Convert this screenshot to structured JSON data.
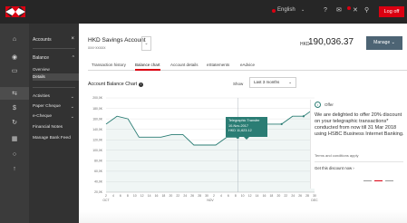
{
  "topbar": {
    "language": "English",
    "language_caret": "⌄",
    "help_icon": "?",
    "mail_icon": "✉",
    "user_icon": "✕",
    "search_icon": "⚲",
    "logout_label": "Log off"
  },
  "rail": {
    "icons": [
      "home-icon",
      "accounts-icon",
      "cards-icon",
      "transfer-icon",
      "payments-icon",
      "exchange-icon",
      "chart-icon",
      "support-icon",
      "pin-icon"
    ]
  },
  "sidebar": {
    "accounts_label": "Accounts",
    "close_glyph": "×",
    "balance_label": "Balance",
    "balance_caret": "^",
    "subitems": [
      "Overview",
      "Details"
    ],
    "items": [
      {
        "label": "Activities",
        "caret": "⌄"
      },
      {
        "label": "Paper Cheque",
        "caret": "⌄"
      },
      {
        "label": "e-Cheque",
        "caret": "⌄"
      },
      {
        "label": "Financial Notes",
        "caret": ""
      },
      {
        "label": "Manage Bank Feed",
        "caret": ""
      }
    ]
  },
  "account": {
    "name": "HKD Savings Account",
    "number": "xxx-xxxxx",
    "currency": "HKD",
    "balance": "190,036.37",
    "manage_label": "Manage",
    "manage_caret": "⌄",
    "drop_caret": "⌄"
  },
  "tabs": [
    "Transaction history",
    "Balance chart",
    "Account details",
    "eStatements",
    "eAdvice"
  ],
  "active_tab": 1,
  "chart_section": {
    "title": "Account Balance Chart",
    "info_glyph": "i",
    "show_label": "Show",
    "range_value": "Last 3 months",
    "range_caret": "⌄"
  },
  "tooltip": {
    "line1": "Telegraphic Transfer",
    "line2": "10-Nov-2017",
    "line3": "HKD 11,623.12"
  },
  "chart_data": {
    "type": "line",
    "title": "Account Balance Chart",
    "y_ticks": [
      "200,0K",
      "180,0K",
      "160,0K",
      "140,0K",
      "120,0K",
      "100,0K",
      "80,0K",
      "60,0K",
      "40,0K",
      "20,0K"
    ],
    "ylim": [
      20,
      200
    ],
    "x_tick_labels": [
      "2",
      "4",
      "6",
      "8",
      "10",
      "12",
      "14",
      "16",
      "18",
      "20",
      "22",
      "24",
      "26",
      "28",
      "30",
      "2",
      "4",
      "6",
      "8",
      "10",
      "12",
      "14",
      "16",
      "18",
      "20",
      "22",
      "24",
      "26",
      "28",
      "30"
    ],
    "month_labels": [
      "OCT",
      "NOV",
      "DEC"
    ],
    "series": [
      {
        "values": [
          150,
          165,
          160,
          125,
          125,
          125,
          130,
          130,
          110,
          110,
          110,
          125,
          125,
          140,
          150,
          150,
          150,
          165,
          165,
          180
        ],
        "color": "#2b7d74"
      }
    ],
    "selected_index": 12,
    "grid": true
  },
  "offer": {
    "icon_glyph": "i",
    "tag": "Offer",
    "text": "We are delighted to offer 20% discount on your telegraphic transactions* conducted from now till 31 Mar 2018 using HSBC Business Internet Banking.",
    "terms_link": "Terms and conditions apply",
    "cta": "Get this discount now ›"
  },
  "colors": {
    "accent": "#db0011",
    "series": "#2b7d74",
    "dark": "#262626"
  }
}
